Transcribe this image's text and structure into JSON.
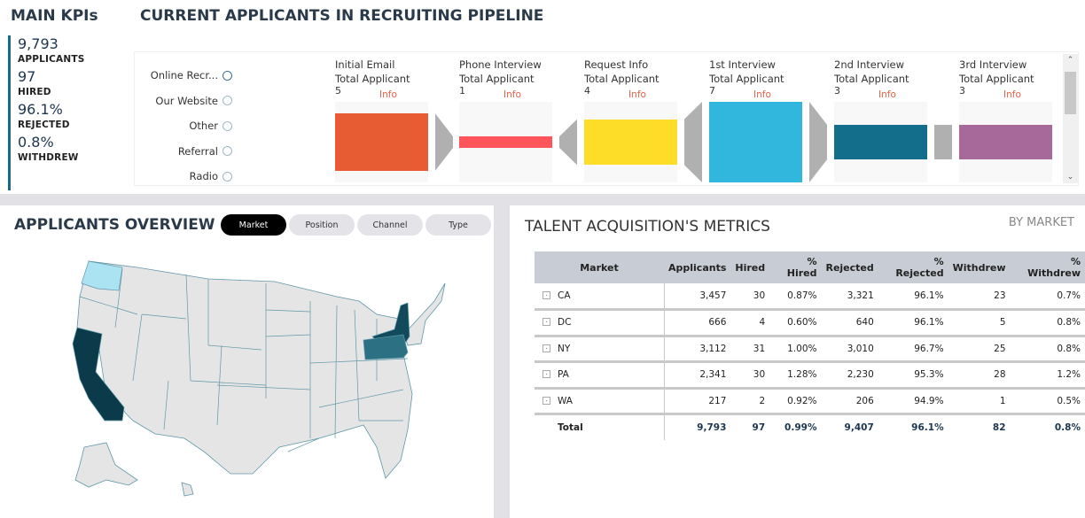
{
  "kpis": {
    "title": "MAIN KPIs",
    "items": [
      {
        "value": "9,793",
        "label": "APPLICANTS"
      },
      {
        "value": "97",
        "label": "HIRED"
      },
      {
        "value": "96.1%",
        "label": "REJECTED"
      },
      {
        "value": "0.8%",
        "label": "WITHDREW"
      }
    ]
  },
  "pipeline": {
    "title": "CURRENT APPLICANTS IN RECRUITING PIPELINE",
    "channels": [
      "Online Recr...",
      "Our Website",
      "Other",
      "Referral",
      "Radio"
    ],
    "stages": [
      {
        "name": "Initial Email",
        "subtitle": "Total Applicant",
        "count": "5",
        "info": "Info",
        "color": "#e85c33",
        "fraction": 0.71
      },
      {
        "name": "Phone Interview",
        "subtitle": "Total Applicant",
        "count": "1",
        "info": "Info",
        "color": "#fd5559",
        "fraction": 0.14
      },
      {
        "name": "Request Info",
        "subtitle": "Total Applicant",
        "count": "4",
        "info": "Info",
        "color": "#fedd29",
        "fraction": 0.57
      },
      {
        "name": "1st Interview",
        "subtitle": "Total Applicant",
        "count": "7",
        "info": "Info",
        "color": "#31b6dd",
        "fraction": 1.0
      },
      {
        "name": "2nd Interview",
        "subtitle": "Total Applicant",
        "count": "3",
        "info": "Info",
        "color": "#126e8a",
        "fraction": 0.43
      },
      {
        "name": "3rd Interview",
        "subtitle": "Total Applicant",
        "count": "3",
        "info": "Info",
        "color": "#a66999",
        "fraction": 0.43
      }
    ]
  },
  "overview": {
    "title": "APPLICANTS OVERVIEW",
    "tabs": [
      "Market",
      "Position",
      "Channel",
      "Type"
    ],
    "active_tab": "Market",
    "map_colors": {
      "CA": "#0b3a4a",
      "NY": "#124a5c",
      "PA": "#2b7083",
      "WA": "#ace3f3",
      "other": "#e5e5e5"
    }
  },
  "metrics": {
    "title": "TALENT ACQUISITION'S METRICS",
    "by": "BY MARKET",
    "columns": [
      "Market",
      "Applicants",
      "Hired",
      "% Hired",
      "Rejected",
      "% Rejected",
      "Withdrew",
      "% Withdrew"
    ],
    "rows": [
      [
        "CA",
        "3,457",
        "30",
        "0.87%",
        "3,321",
        "96.1%",
        "23",
        "0.7%"
      ],
      [
        "DC",
        "666",
        "4",
        "0.60%",
        "640",
        "96.1%",
        "5",
        "0.8%"
      ],
      [
        "NY",
        "3,112",
        "31",
        "1.00%",
        "3,010",
        "96.7%",
        "25",
        "0.8%"
      ],
      [
        "PA",
        "2,341",
        "30",
        "1.28%",
        "2,230",
        "95.3%",
        "28",
        "1.2%"
      ],
      [
        "WA",
        "217",
        "2",
        "0.92%",
        "206",
        "94.9%",
        "1",
        "0.5%"
      ]
    ],
    "total": [
      "Total",
      "9,793",
      "97",
      "0.99%",
      "9,407",
      "96.1%",
      "82",
      "0.8%"
    ]
  }
}
